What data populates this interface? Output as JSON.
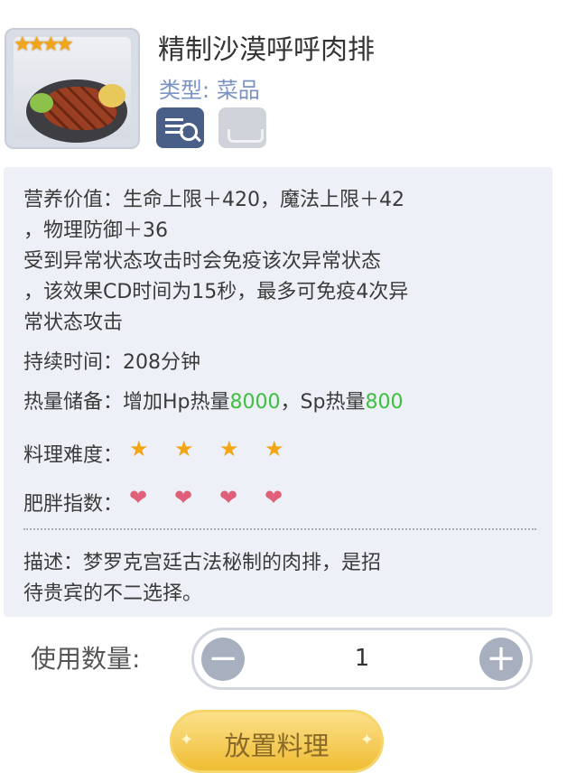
{
  "item": {
    "name": "精制沙漠呼呼肉排",
    "type_label": "类型:",
    "type_value": "菜品",
    "stars": 4,
    "icon": "steak-dish-icon",
    "badges": [
      "detail-search-icon",
      "tray-icon"
    ]
  },
  "info": {
    "nutrition_line1": "营养价值：生命上限＋420，魔法上限＋42",
    "nutrition_line2": "，物理防御＋36",
    "effect_line1": "受到异常状态攻击时会免疫该次异常状态",
    "effect_line2": "，该效果CD时间为15秒，最多可免疫4次异",
    "effect_line3": "常状态攻击",
    "duration": "持续时间：208分钟",
    "heat_prefix": "热量储备：增加Hp热量",
    "heat_hp": "8000",
    "heat_mid": "，Sp热量",
    "heat_sp": "800",
    "difficulty_label": "料理难度：",
    "difficulty": 4,
    "fatness_label": "肥胖指数：",
    "fatness": 4,
    "desc_line1": "描述：梦罗克宫廷古法秘制的肉排，是招",
    "desc_line2": "待贵宾的不二选择。"
  },
  "quantity": {
    "label": "使用数量:",
    "value": "1",
    "minus_icon": "minus-icon",
    "plus_icon": "plus-icon"
  },
  "action": {
    "place_label": "放置料理"
  },
  "colors": {
    "accent_green": "#3fbf3f",
    "star": "#f2a516",
    "heart": "#e0607a",
    "button_gold": "#f0bd34"
  }
}
